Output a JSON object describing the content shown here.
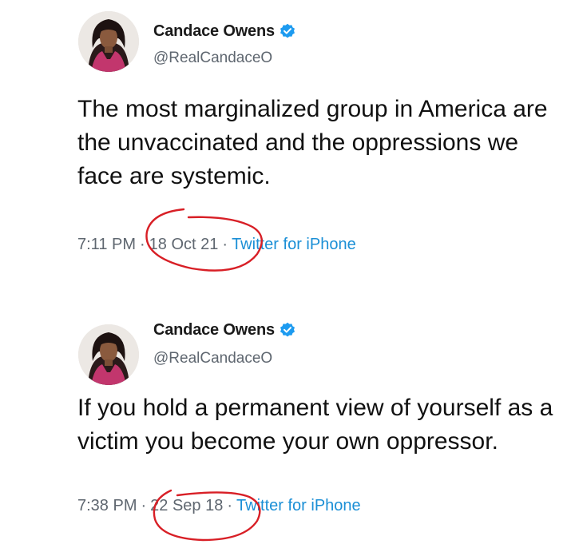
{
  "tweets": [
    {
      "author": {
        "display_name": "Candace Owens",
        "handle": "@RealCandaceO",
        "verified": true,
        "avatar_icon": "profile-photo"
      },
      "text": "The most marginalized group in America are the unvaccinated and the oppressions we face are systemic.",
      "meta": {
        "time": "7:11 PM",
        "separator": "·",
        "date": "18 Oct 21",
        "source": "Twitter for iPhone"
      }
    },
    {
      "author": {
        "display_name": "Candace Owens",
        "handle": "@RealCandaceO",
        "verified": true,
        "avatar_icon": "profile-photo"
      },
      "text": "If you hold a permanent view of yourself as a victim you become your own oppressor.",
      "meta": {
        "time": "7:38 PM",
        "separator": "·",
        "date": "22 Sep 18",
        "source": "Twitter for iPhone"
      }
    }
  ],
  "colors": {
    "verified_badge": "#1d9bf0",
    "source_link": "#1b8fd6",
    "annotation_circle": "#d81f26",
    "secondary_text": "#5f6770"
  }
}
